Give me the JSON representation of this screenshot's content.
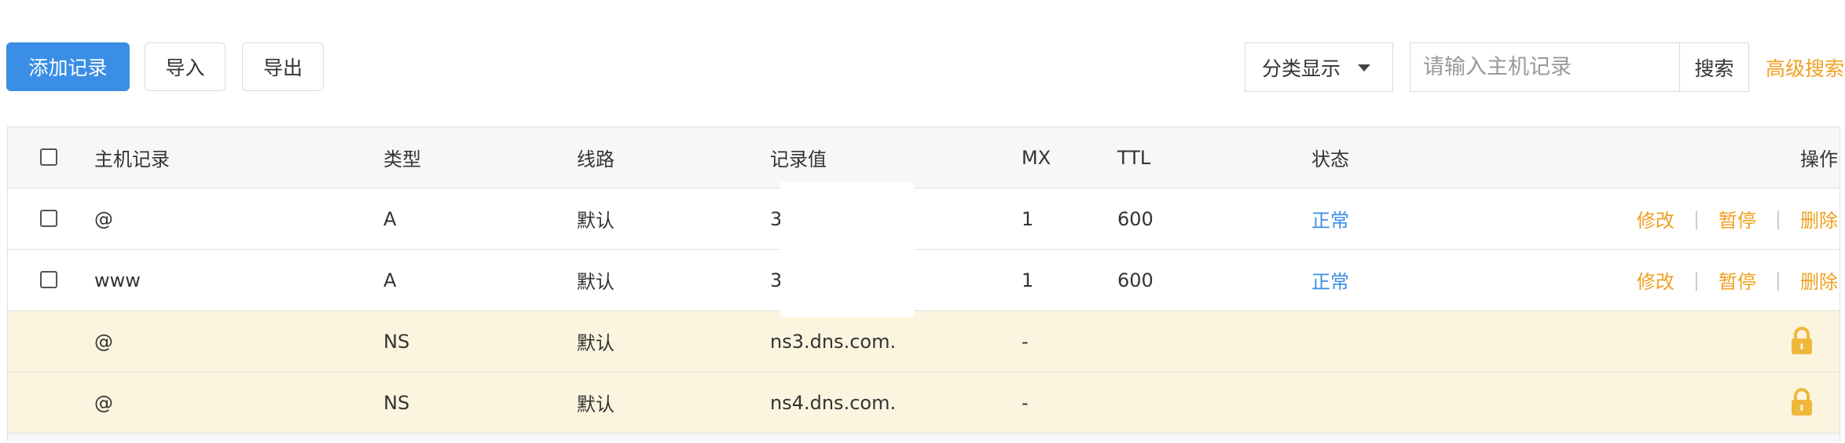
{
  "toolbar": {
    "add_record": "添加记录",
    "import": "导入",
    "export": "导出",
    "category_select": "分类显示",
    "search_placeholder": "请输入主机记录",
    "search_button": "搜索",
    "advanced_search": "高级搜索"
  },
  "table": {
    "headers": {
      "host": "主机记录",
      "type": "类型",
      "line": "线路",
      "value": "记录值",
      "mx": "MX",
      "ttl": "TTL",
      "status": "状态",
      "actions": "操作"
    },
    "rows": [
      {
        "host": "@",
        "type": "A",
        "line": "默认",
        "value": "3",
        "mx": "1",
        "ttl": "600",
        "status": "正常",
        "edit": "修改",
        "pause": "暂停",
        "delete": "删除",
        "separator": "|"
      },
      {
        "host": "www",
        "type": "A",
        "line": "默认",
        "value": "3",
        "mx": "1",
        "ttl": "600",
        "status": "正常",
        "edit": "修改",
        "pause": "暂停",
        "delete": "删除",
        "separator": "|"
      },
      {
        "host": "@",
        "type": "NS",
        "line": "默认",
        "value": "ns3.dns.com.",
        "mx": "-",
        "locked_icon": "lock-icon"
      },
      {
        "host": "@",
        "type": "NS",
        "line": "默认",
        "value": "ns4.dns.com.",
        "mx": "-",
        "locked_icon": "lock-icon"
      }
    ]
  },
  "colors": {
    "primary": "#3a8ee6",
    "link_orange": "#f0a020",
    "locked_row_bg": "#fbf4df",
    "header_bg": "#f7f7f7"
  }
}
